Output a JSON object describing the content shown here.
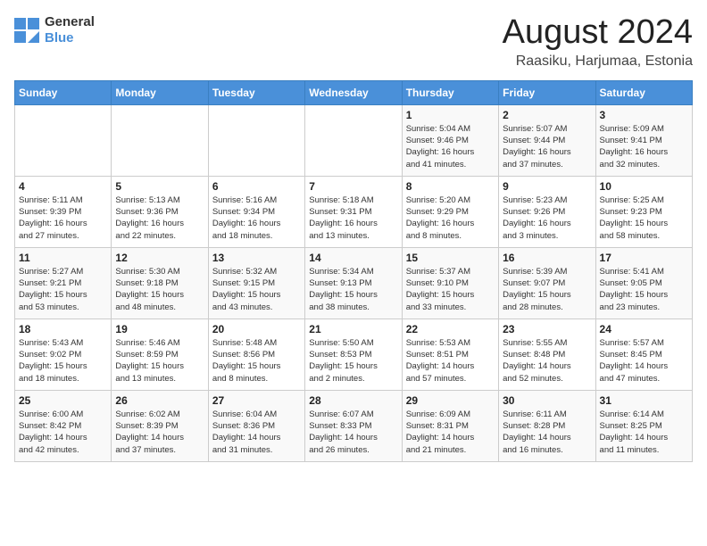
{
  "logo": {
    "text_general": "General",
    "text_blue": "Blue"
  },
  "title": "August 2024",
  "location": "Raasiku, Harjumaa, Estonia",
  "days_of_week": [
    "Sunday",
    "Monday",
    "Tuesday",
    "Wednesday",
    "Thursday",
    "Friday",
    "Saturday"
  ],
  "weeks": [
    [
      {
        "day": "",
        "info": ""
      },
      {
        "day": "",
        "info": ""
      },
      {
        "day": "",
        "info": ""
      },
      {
        "day": "",
        "info": ""
      },
      {
        "day": "1",
        "info": "Sunrise: 5:04 AM\nSunset: 9:46 PM\nDaylight: 16 hours\nand 41 minutes."
      },
      {
        "day": "2",
        "info": "Sunrise: 5:07 AM\nSunset: 9:44 PM\nDaylight: 16 hours\nand 37 minutes."
      },
      {
        "day": "3",
        "info": "Sunrise: 5:09 AM\nSunset: 9:41 PM\nDaylight: 16 hours\nand 32 minutes."
      }
    ],
    [
      {
        "day": "4",
        "info": "Sunrise: 5:11 AM\nSunset: 9:39 PM\nDaylight: 16 hours\nand 27 minutes."
      },
      {
        "day": "5",
        "info": "Sunrise: 5:13 AM\nSunset: 9:36 PM\nDaylight: 16 hours\nand 22 minutes."
      },
      {
        "day": "6",
        "info": "Sunrise: 5:16 AM\nSunset: 9:34 PM\nDaylight: 16 hours\nand 18 minutes."
      },
      {
        "day": "7",
        "info": "Sunrise: 5:18 AM\nSunset: 9:31 PM\nDaylight: 16 hours\nand 13 minutes."
      },
      {
        "day": "8",
        "info": "Sunrise: 5:20 AM\nSunset: 9:29 PM\nDaylight: 16 hours\nand 8 minutes."
      },
      {
        "day": "9",
        "info": "Sunrise: 5:23 AM\nSunset: 9:26 PM\nDaylight: 16 hours\nand 3 minutes."
      },
      {
        "day": "10",
        "info": "Sunrise: 5:25 AM\nSunset: 9:23 PM\nDaylight: 15 hours\nand 58 minutes."
      }
    ],
    [
      {
        "day": "11",
        "info": "Sunrise: 5:27 AM\nSunset: 9:21 PM\nDaylight: 15 hours\nand 53 minutes."
      },
      {
        "day": "12",
        "info": "Sunrise: 5:30 AM\nSunset: 9:18 PM\nDaylight: 15 hours\nand 48 minutes."
      },
      {
        "day": "13",
        "info": "Sunrise: 5:32 AM\nSunset: 9:15 PM\nDaylight: 15 hours\nand 43 minutes."
      },
      {
        "day": "14",
        "info": "Sunrise: 5:34 AM\nSunset: 9:13 PM\nDaylight: 15 hours\nand 38 minutes."
      },
      {
        "day": "15",
        "info": "Sunrise: 5:37 AM\nSunset: 9:10 PM\nDaylight: 15 hours\nand 33 minutes."
      },
      {
        "day": "16",
        "info": "Sunrise: 5:39 AM\nSunset: 9:07 PM\nDaylight: 15 hours\nand 28 minutes."
      },
      {
        "day": "17",
        "info": "Sunrise: 5:41 AM\nSunset: 9:05 PM\nDaylight: 15 hours\nand 23 minutes."
      }
    ],
    [
      {
        "day": "18",
        "info": "Sunrise: 5:43 AM\nSunset: 9:02 PM\nDaylight: 15 hours\nand 18 minutes."
      },
      {
        "day": "19",
        "info": "Sunrise: 5:46 AM\nSunset: 8:59 PM\nDaylight: 15 hours\nand 13 minutes."
      },
      {
        "day": "20",
        "info": "Sunrise: 5:48 AM\nSunset: 8:56 PM\nDaylight: 15 hours\nand 8 minutes."
      },
      {
        "day": "21",
        "info": "Sunrise: 5:50 AM\nSunset: 8:53 PM\nDaylight: 15 hours\nand 2 minutes."
      },
      {
        "day": "22",
        "info": "Sunrise: 5:53 AM\nSunset: 8:51 PM\nDaylight: 14 hours\nand 57 minutes."
      },
      {
        "day": "23",
        "info": "Sunrise: 5:55 AM\nSunset: 8:48 PM\nDaylight: 14 hours\nand 52 minutes."
      },
      {
        "day": "24",
        "info": "Sunrise: 5:57 AM\nSunset: 8:45 PM\nDaylight: 14 hours\nand 47 minutes."
      }
    ],
    [
      {
        "day": "25",
        "info": "Sunrise: 6:00 AM\nSunset: 8:42 PM\nDaylight: 14 hours\nand 42 minutes."
      },
      {
        "day": "26",
        "info": "Sunrise: 6:02 AM\nSunset: 8:39 PM\nDaylight: 14 hours\nand 37 minutes."
      },
      {
        "day": "27",
        "info": "Sunrise: 6:04 AM\nSunset: 8:36 PM\nDaylight: 14 hours\nand 31 minutes."
      },
      {
        "day": "28",
        "info": "Sunrise: 6:07 AM\nSunset: 8:33 PM\nDaylight: 14 hours\nand 26 minutes."
      },
      {
        "day": "29",
        "info": "Sunrise: 6:09 AM\nSunset: 8:31 PM\nDaylight: 14 hours\nand 21 minutes."
      },
      {
        "day": "30",
        "info": "Sunrise: 6:11 AM\nSunset: 8:28 PM\nDaylight: 14 hours\nand 16 minutes."
      },
      {
        "day": "31",
        "info": "Sunrise: 6:14 AM\nSunset: 8:25 PM\nDaylight: 14 hours\nand 11 minutes."
      }
    ]
  ]
}
